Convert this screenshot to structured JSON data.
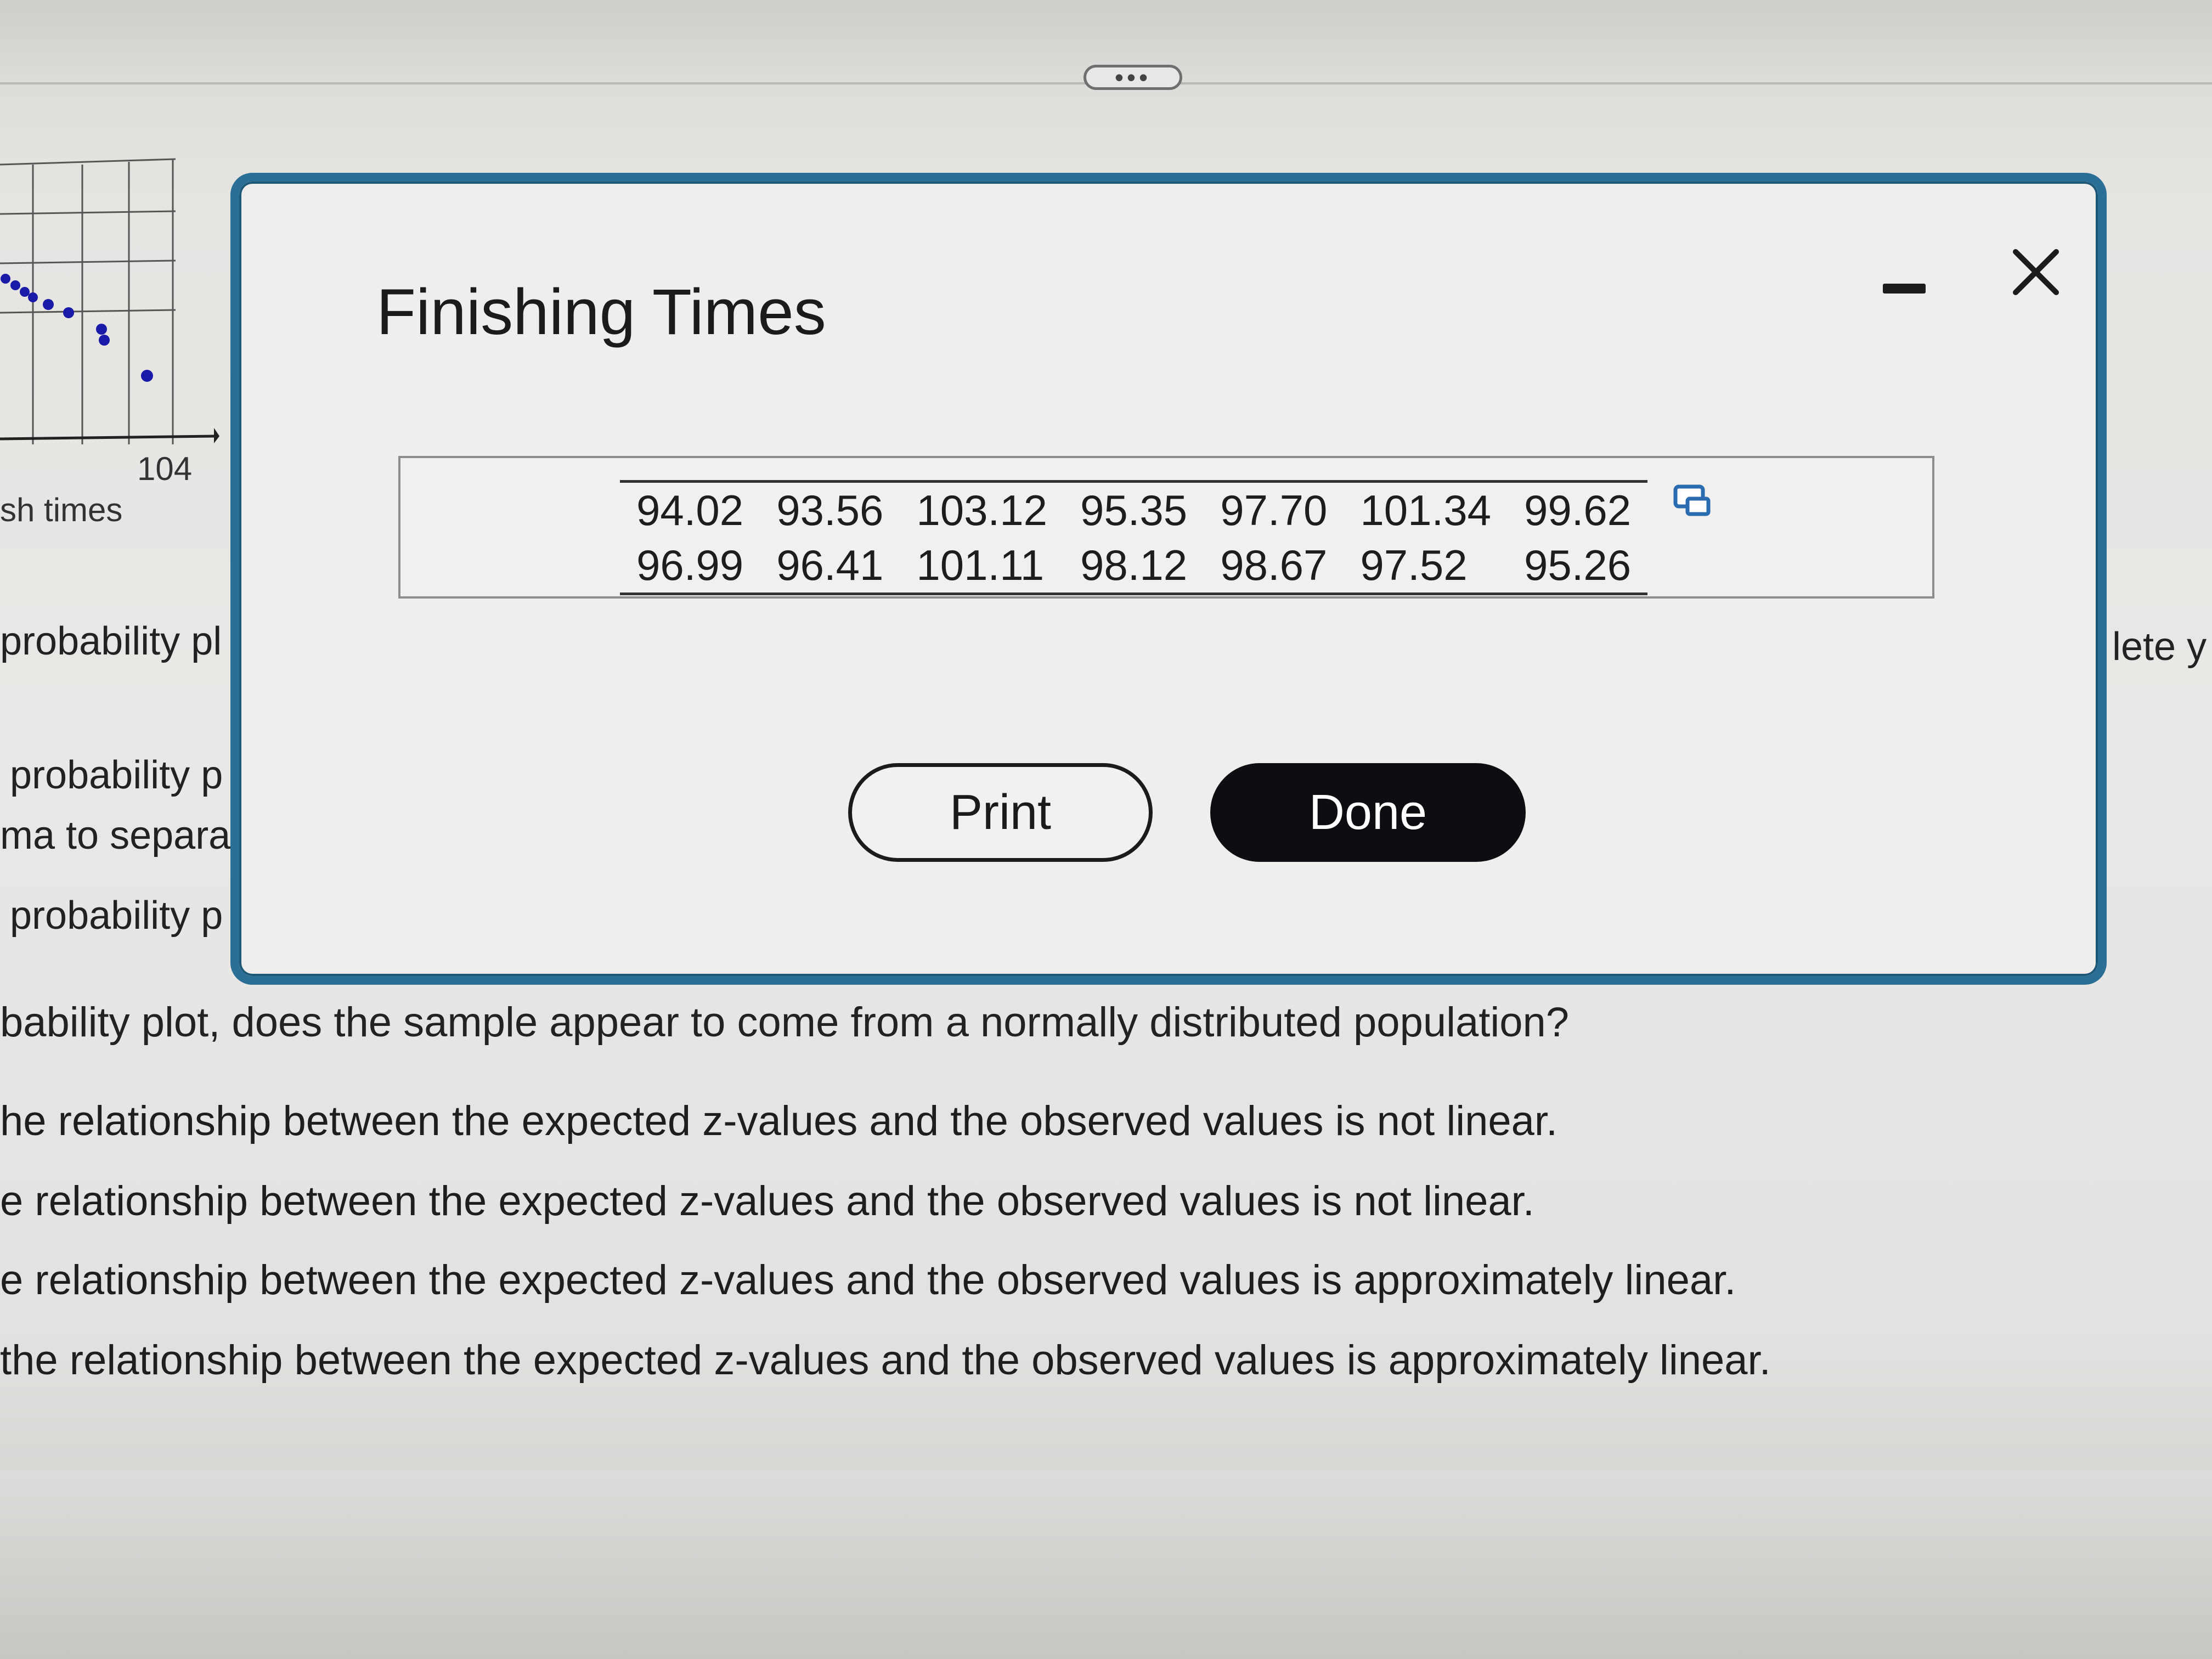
{
  "background_page": {
    "plot_tick_label": "104",
    "plot_axis_label": "sh times",
    "fragment_left_1": "probability pl",
    "fragment_right": "lete y",
    "fragment_left_2": "probability p",
    "fragment_left_3": "ma to separa",
    "fragment_left_4": "probability p",
    "question": "bability plot, does the sample appear to come from a normally distributed population?",
    "answers": [
      "he relationship between the expected z-values and the observed values is not linear.",
      "e relationship between the expected z-values and the observed values is not linear.",
      "e relationship between the expected z-values and the observed values is approximately linear.",
      "the relationship between the expected z-values and the observed values is approximately linear."
    ]
  },
  "dialog": {
    "title": "Finishing Times",
    "table": [
      [
        "94.02",
        "93.56",
        "103.12",
        "95.35",
        "97.70",
        "101.34",
        "99.62"
      ],
      [
        "96.99",
        "96.41",
        "101.11",
        "98.12",
        "98.67",
        "97.52",
        "95.26"
      ]
    ],
    "print_label": "Print",
    "done_label": "Done",
    "icons": {
      "minimize": "minimize-icon",
      "close": "close-icon",
      "copy": "copy-to-spreadsheet-icon"
    }
  },
  "colors": {
    "dialog_border": "#2b6e96",
    "done_button": "#0d0d12",
    "plot_points": "#1a1aa8"
  }
}
